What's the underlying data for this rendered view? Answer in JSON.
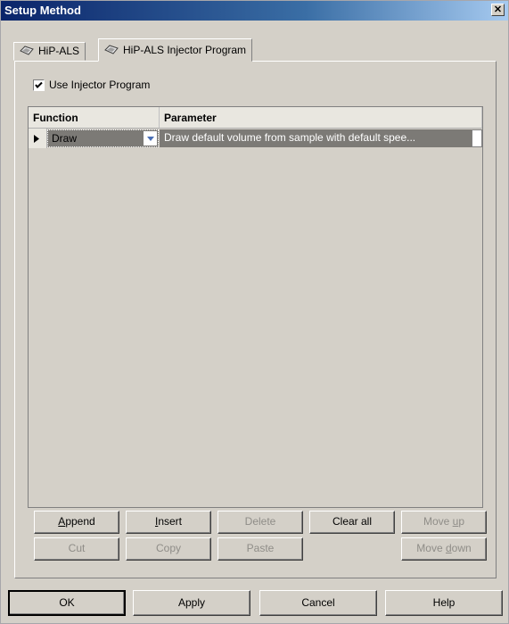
{
  "window": {
    "title": "Setup Method",
    "close_glyph": "✕"
  },
  "tabs": [
    {
      "label": "HiP-ALS",
      "icon": "module-icon"
    },
    {
      "label": "HiP-ALS Injector Program",
      "icon": "module-icon"
    }
  ],
  "options": {
    "use_injector_program_label": "Use Injector Program",
    "use_injector_program_checked": true
  },
  "table": {
    "columns": [
      "Function",
      "Parameter"
    ],
    "rows": [
      {
        "function": "Draw",
        "parameter": "Draw default volume  from sample with default spee..."
      }
    ]
  },
  "buttons": {
    "append": {
      "pre": "",
      "u": "A",
      "post": "ppend"
    },
    "insert": {
      "pre": "",
      "u": "I",
      "post": "nsert"
    },
    "delete": "Delete",
    "clear_all": "Clear all",
    "move_up": {
      "pre": "Move ",
      "u": "u",
      "post": "p"
    },
    "cut": "Cut",
    "copy": "Copy",
    "paste": "Paste",
    "move_down": {
      "pre": "Move ",
      "u": "d",
      "post": "own"
    }
  },
  "footer": {
    "ok": "OK",
    "apply": "Apply",
    "cancel": "Cancel",
    "help": "Help"
  }
}
